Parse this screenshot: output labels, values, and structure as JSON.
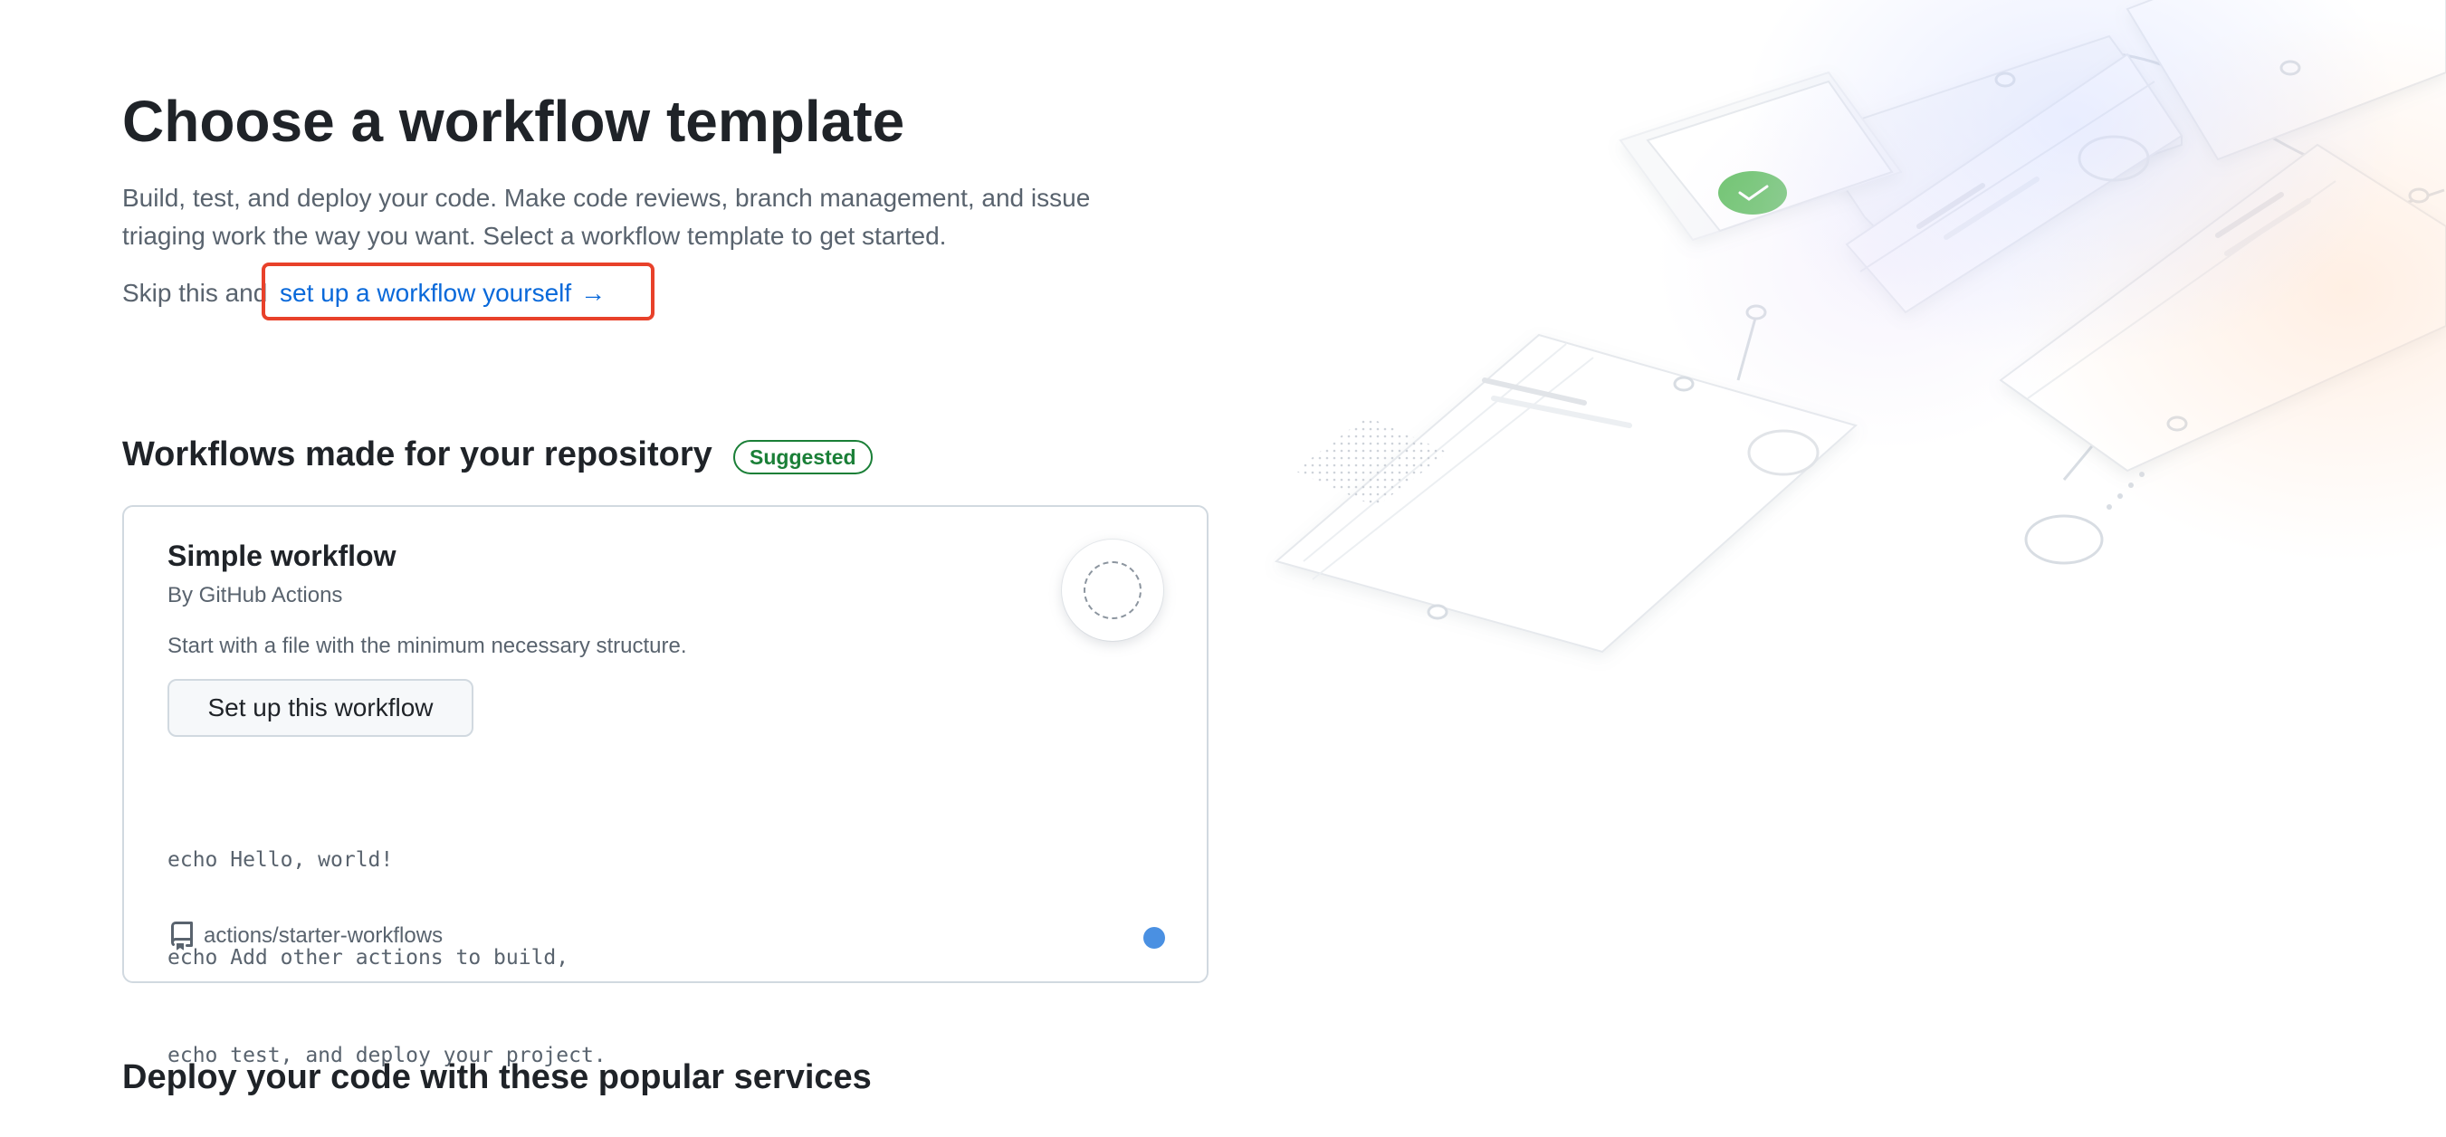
{
  "header": {
    "title": "Choose a workflow template",
    "description": "Build, test, and deploy your code. Make code reviews, branch management, and issue triaging work the way you want. Select a workflow template to get started.",
    "skip_prefix": "Skip this and",
    "setup_link": "set up a workflow yourself",
    "arrow": "→"
  },
  "suggested_section": {
    "title": "Workflows made for your repository",
    "badge": "Suggested",
    "badge_color": "#1a7f37",
    "cards": [
      {
        "title": "Simple workflow",
        "author": "By GitHub Actions",
        "description": "Start with a file with the minimum necessary structure.",
        "button_label": "Set up this workflow",
        "code_lines": [
          "echo Hello, world!",
          "echo Add other actions to build,",
          "echo test, and deploy your project."
        ],
        "repo": "actions/starter-workflows",
        "repo_icon": "repo-icon",
        "logo_icon": "workflow-icon",
        "dot_color": "#4a90e2"
      }
    ]
  },
  "next_section": {
    "title": "Deploy your code with these popular services"
  },
  "colors": {
    "link": "#0969da",
    "highlight": "#e8412a",
    "success": "#6cc36c"
  }
}
